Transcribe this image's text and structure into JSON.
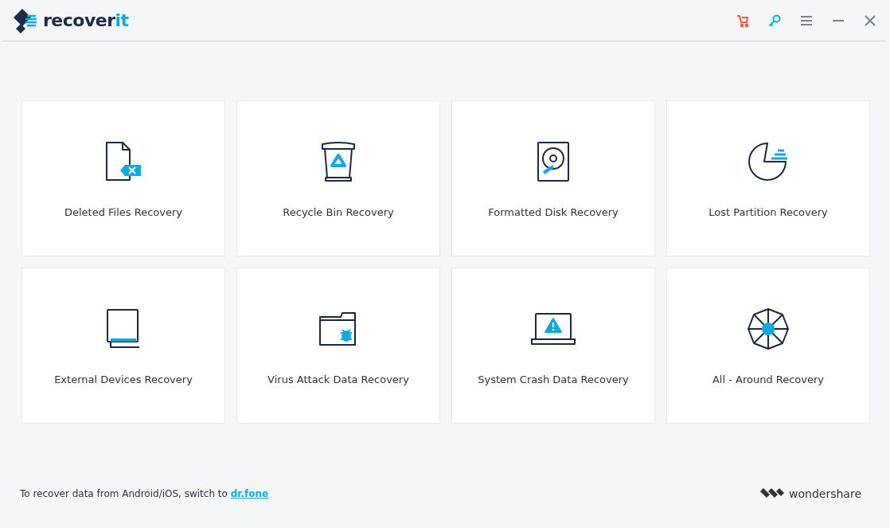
{
  "logo": {
    "text": "recover",
    "accent": "it"
  },
  "toolbar": [
    {
      "kind": "cart"
    },
    {
      "kind": "key"
    },
    {
      "kind": "menu"
    },
    {
      "kind": "minimize"
    },
    {
      "kind": "close"
    }
  ],
  "cards": [
    {
      "kind": "deleted",
      "label": "Deleted Files Recovery"
    },
    {
      "kind": "recycle",
      "label": "Recycle Bin Recovery"
    },
    {
      "kind": "disk",
      "label": "Formatted Disk Recovery"
    },
    {
      "kind": "partition",
      "label": "Lost Partition Recovery"
    },
    {
      "kind": "external",
      "label": "External Devices Recovery"
    },
    {
      "kind": "virus",
      "label": "Virus Attack Data Recovery"
    },
    {
      "kind": "crash",
      "label": "System Crash Data Recovery"
    },
    {
      "kind": "all",
      "label": "All - Around Recovery"
    }
  ],
  "footer": {
    "note": "To recover data from Android/iOS, switch to",
    "link": "dr.fone",
    "brand": "wondershare"
  }
}
